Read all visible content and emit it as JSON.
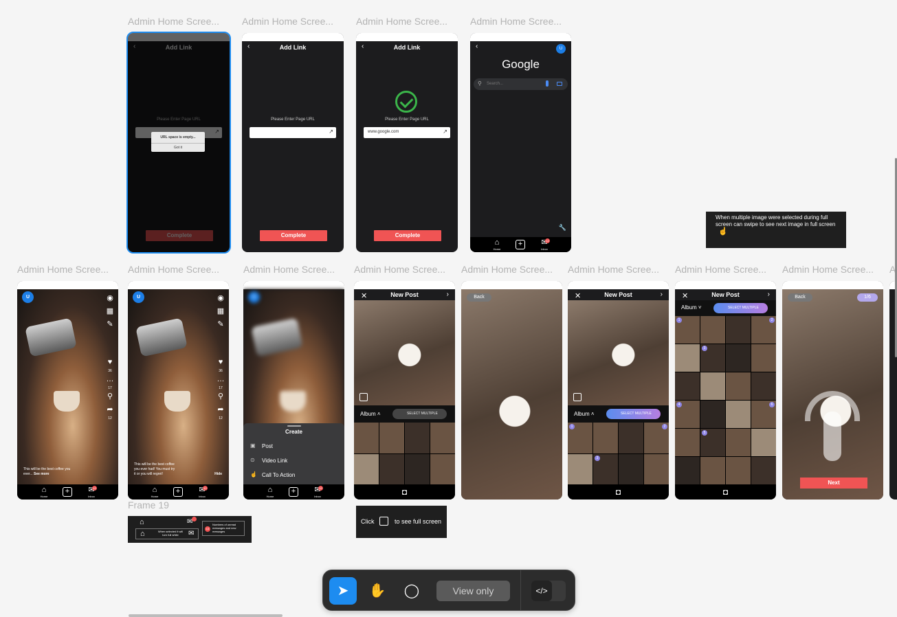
{
  "frame_label": "Admin Home Scree...",
  "add_link": {
    "title": "Add Link",
    "hint": "Please Enter Page URL",
    "complete": "Complete",
    "dialog_title": "URL space is empty...",
    "dialog_button": "Got it",
    "url_value": "www.google.com"
  },
  "google": {
    "logo": "Google",
    "search_placeholder": "Search..."
  },
  "nav": {
    "home": "Home",
    "inbox": "Inbox",
    "badge": "12"
  },
  "post": {
    "caption_short": "This will be the best coffee you ever...",
    "see_more": "See more",
    "caption_full": "This will be the best coffee you ever had! You must try it or you will regret!",
    "hide": "Hide",
    "likes": "36",
    "comments": "17",
    "shares": "12"
  },
  "create_sheet": {
    "title": "Create",
    "items": [
      {
        "label": "Post",
        "icon": "image-icon"
      },
      {
        "label": "Video Link",
        "icon": "play-icon"
      },
      {
        "label": "Call To Action",
        "icon": "hand-icon"
      }
    ]
  },
  "new_post": {
    "title": "New Post",
    "album": "Album",
    "select_multiple": "SELECT MULTIPLE",
    "back": "Back",
    "pager": "1/6",
    "next": "Next"
  },
  "notes": {
    "multi_image": "When multiple image were selected during full screen can swipe to see next image in full screen",
    "click": "Click",
    "full_screen": "to see full screen",
    "frame19_label": "Frame 19",
    "when_selected": "When selected it will turn full white",
    "unread": "Numbers of unread messages and new messages",
    "unread_badge": "13"
  },
  "toolbar": {
    "view_only": "View only"
  },
  "colors": {
    "accent": "#1d8cf0",
    "danger": "#f05454",
    "success": "#3bb54a"
  }
}
